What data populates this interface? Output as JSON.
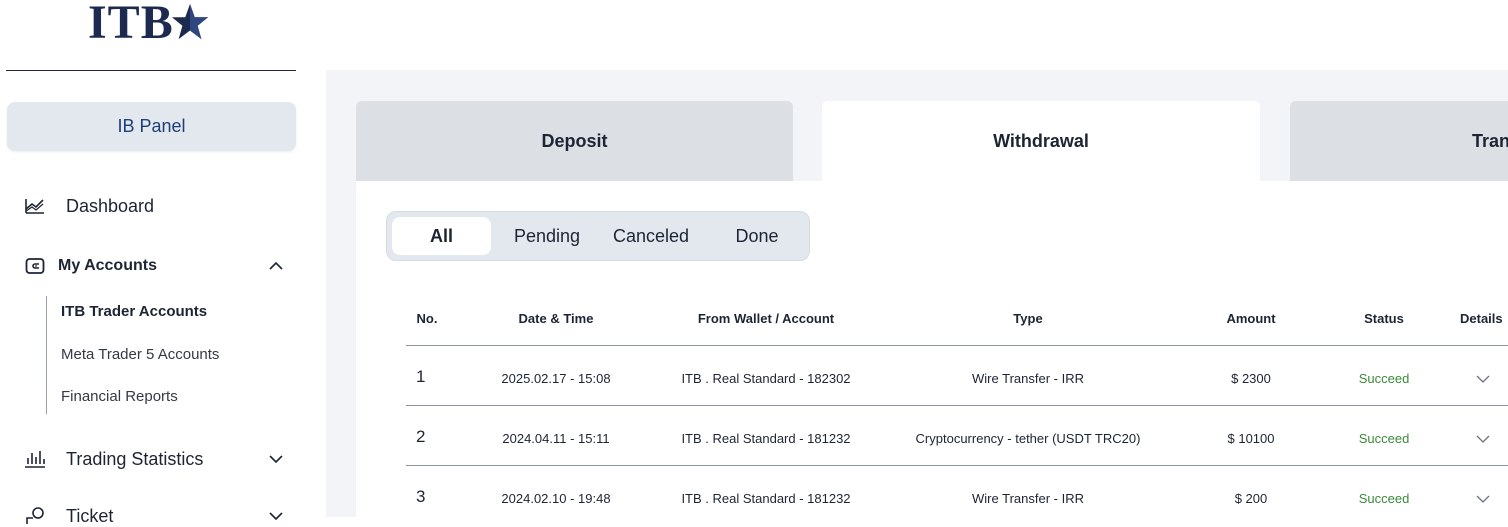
{
  "brand": {
    "logo_text": "ITB"
  },
  "sidebar": {
    "panel_button": "IB Panel",
    "nav": {
      "dashboard": "Dashboard",
      "my_accounts": "My Accounts",
      "trading_statistics": "Trading Statistics",
      "ticket": "Ticket"
    },
    "accounts_sub": [
      "ITB Trader Accounts",
      "Meta Trader 5 Accounts",
      "Financial Reports"
    ]
  },
  "tabs": [
    "Deposit",
    "Withdrawal",
    "Tran"
  ],
  "active_tab": "Withdrawal",
  "filters": [
    "All",
    "Pending",
    "Canceled",
    "Done"
  ],
  "active_filter": "All",
  "table": {
    "headers": [
      "No.",
      "Date & Time",
      "From Wallet / Account",
      "Type",
      "Amount",
      "Status",
      "Details"
    ],
    "rows": [
      {
        "no": "1",
        "datetime": "2025.02.17 - 15:08",
        "from": "ITB . Real Standard - 182302",
        "type": "Wire Transfer - IRR",
        "amount": "$ 2300",
        "status": "Succeed"
      },
      {
        "no": "2",
        "datetime": "2024.04.11 - 15:11",
        "from": "ITB . Real Standard - 181232",
        "type": "Cryptocurrency - tether (USDT TRC20)",
        "amount": "$ 10100",
        "status": "Succeed"
      },
      {
        "no": "3",
        "datetime": "2024.02.10 - 19:48",
        "from": "ITB . Real Standard - 181232",
        "type": "Wire Transfer - IRR",
        "amount": "$ 200",
        "status": "Succeed"
      }
    ]
  },
  "colors": {
    "brand_navy": "#1b2a4e",
    "panel_bg": "#e3e8ef",
    "status_green": "#3a8a3a",
    "main_bg": "#f2f4f7"
  }
}
